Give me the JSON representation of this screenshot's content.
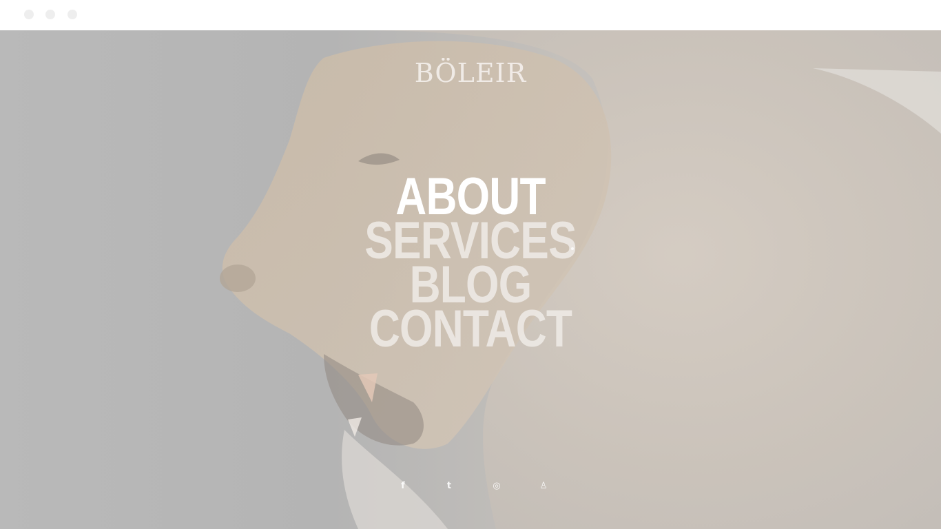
{
  "window": {
    "controls": [
      "close-dot",
      "minimize-dot",
      "maximize-dot"
    ]
  },
  "brand": {
    "logo_text": "BÖLEIR"
  },
  "navigation": {
    "items": [
      {
        "label": "ABOUT",
        "state": "active"
      },
      {
        "label": "SERVICES",
        "state": "inactive"
      },
      {
        "label": "BLOG",
        "state": "inactive"
      },
      {
        "label": "CONTACT",
        "state": "inactive"
      }
    ]
  },
  "social": {
    "icons": [
      "facebook-icon",
      "twitter-icon",
      "instagram-icon",
      "user-icon"
    ],
    "glyphs": [
      "f",
      "t",
      "◎",
      "♙"
    ]
  },
  "colors": {
    "overlay": "#b9b9b9",
    "nav_active": "#ffffff",
    "nav_inactive": "#f0ece8"
  }
}
